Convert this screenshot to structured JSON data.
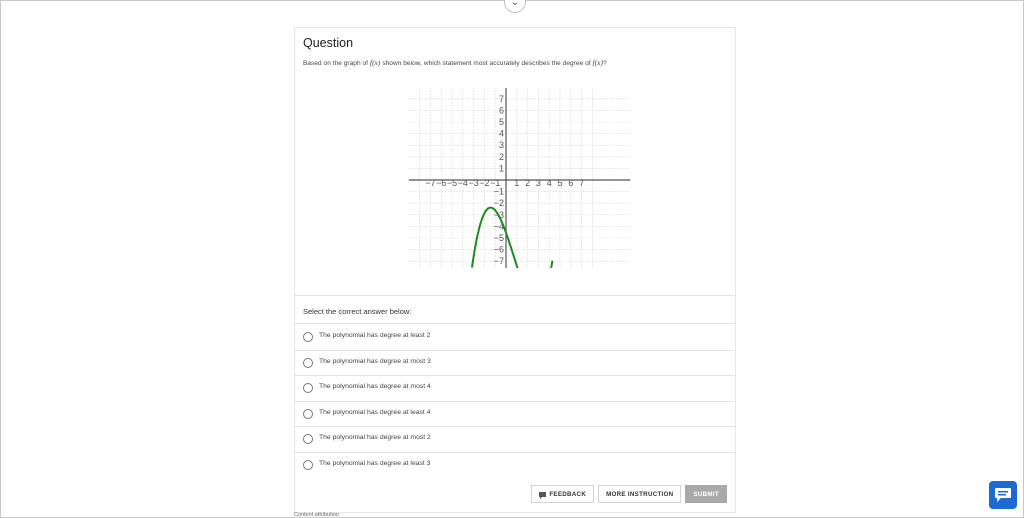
{
  "header": {
    "toggle_icon": "chevron-down-icon"
  },
  "question": {
    "title": "Question",
    "prompt_prefix": "Based on the graph of",
    "prompt_func1": "f(x)",
    "prompt_middle": "shown below, which statement most accurately describes the degree of",
    "prompt_func2": "f(x)",
    "prompt_suffix": "?"
  },
  "graph": {
    "x_ticks": [
      "−7",
      "−6",
      "−5",
      "−4",
      "−3",
      "−2",
      "−1",
      "1",
      "2",
      "3",
      "4",
      "5",
      "6",
      "7"
    ],
    "y_ticks": [
      "7",
      "6",
      "5",
      "4",
      "3",
      "2",
      "1",
      "−1",
      "−2",
      "−3",
      "−4",
      "−5",
      "−6",
      "−7"
    ],
    "curve_color": "#1e8a1e"
  },
  "answers": {
    "select_label": "Select the correct answer below:",
    "options": [
      "The polynomial has degree at least 2",
      "The polynomial has degree at most 3",
      "The polynomial has degree at most 4",
      "The polynomial has degree at least 4",
      "The polynomial has degree at most 2",
      "The polynomial has degree at least 3"
    ]
  },
  "actions": {
    "feedback_label": "FEEDBACK",
    "more_instruction_label": "MORE INSTRUCTION",
    "submit_label": "SUBMIT"
  },
  "footer": {
    "attribution": "Content attribution"
  },
  "chat": {
    "icon": "chat-icon",
    "color": "#1f6ad1"
  }
}
